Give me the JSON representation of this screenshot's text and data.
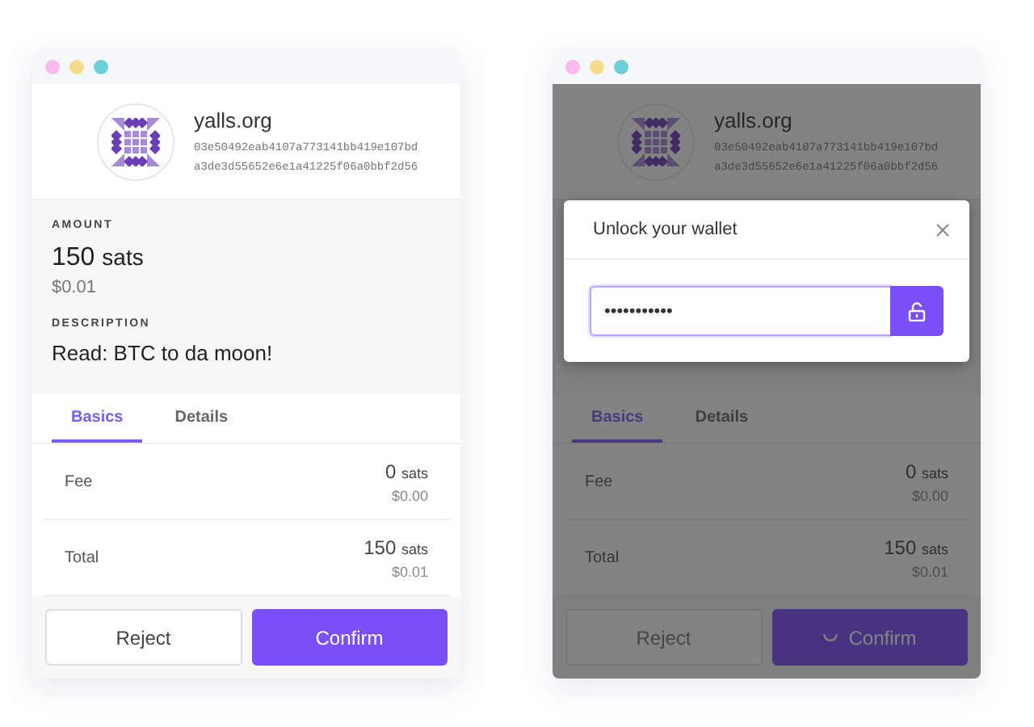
{
  "windows": [
    {
      "header": {
        "site": "yalls.org",
        "pubkey_lines": [
          "03e50492eab4107a773141bb419e107bd",
          "a3de3d55652e6e1a41225f06a0bbf2d56"
        ]
      },
      "amount": {
        "label": "AMOUNT",
        "value": "150",
        "unit": "sats",
        "fiat": "$0.01"
      },
      "description": {
        "label": "DESCRIPTION",
        "text": "Read: BTC to da moon!"
      },
      "tabs": [
        {
          "label": "Basics",
          "selected": true
        },
        {
          "label": "Details",
          "selected": false
        }
      ],
      "rows": [
        {
          "label": "Fee",
          "value": "0",
          "unit": "sats",
          "fiat": "$0.00"
        },
        {
          "label": "Total",
          "value": "150",
          "unit": "sats",
          "fiat": "$0.01"
        }
      ],
      "reject": {
        "label": "Reject",
        "disabled": false
      },
      "confirm": {
        "label": "Confirm",
        "loading": false
      }
    },
    {
      "header": {
        "site": "yalls.org",
        "pubkey_lines": [
          "03e50492eab4107a773141bb419e107bd",
          "a3de3d55652e6e1a41225f06a0bbf2d56"
        ]
      },
      "tabs": [
        {
          "label": "Basics",
          "selected": true
        },
        {
          "label": "Details",
          "selected": false
        }
      ],
      "rows": [
        {
          "label": "Fee",
          "value": "0",
          "unit": "sats",
          "fiat": "$0.00"
        },
        {
          "label": "Total",
          "value": "150",
          "unit": "sats",
          "fiat": "$0.01"
        }
      ],
      "reject": {
        "label": "Reject",
        "disabled": true
      },
      "confirm": {
        "label": "Confirm",
        "loading": true
      },
      "modal": {
        "title": "Unlock your wallet",
        "password": "•••••••••••"
      }
    }
  ]
}
